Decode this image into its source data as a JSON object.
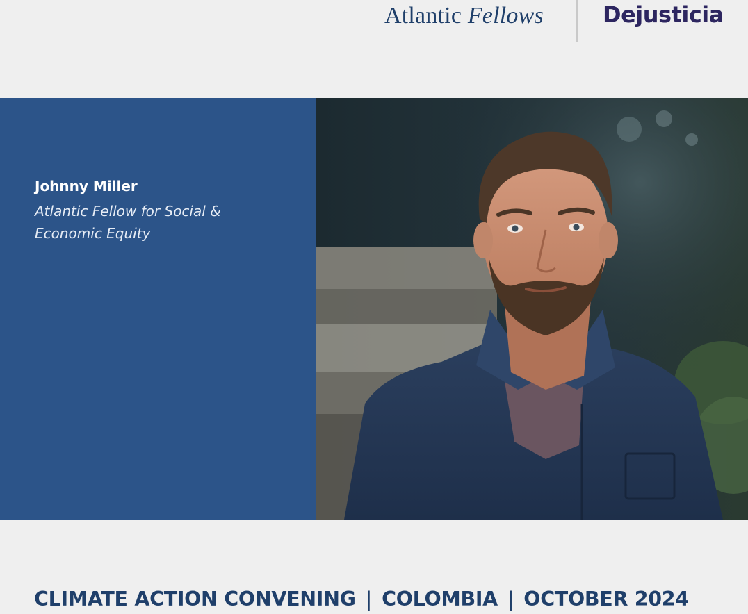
{
  "header": {
    "atlantic_fellows_logo": {
      "word1": "Atlantic",
      "word2": "Fellows"
    },
    "dejusticia_logo": "Dejusticia"
  },
  "profile": {
    "name": "Johnny Miller",
    "role": "Atlantic Fellow for Social & Economic Equity"
  },
  "photo": {
    "icon": "portrait-photo"
  },
  "footer": {
    "event": "CLIMATE ACTION CONVENING",
    "separator": "|",
    "location": "COLOMBIA",
    "date": "OCTOBER 2024"
  },
  "colors": {
    "brand_blue": "#2c5489",
    "text_navy": "#1f3f6a",
    "dejusticia_purple": "#2d2660",
    "background": "#efefef"
  }
}
